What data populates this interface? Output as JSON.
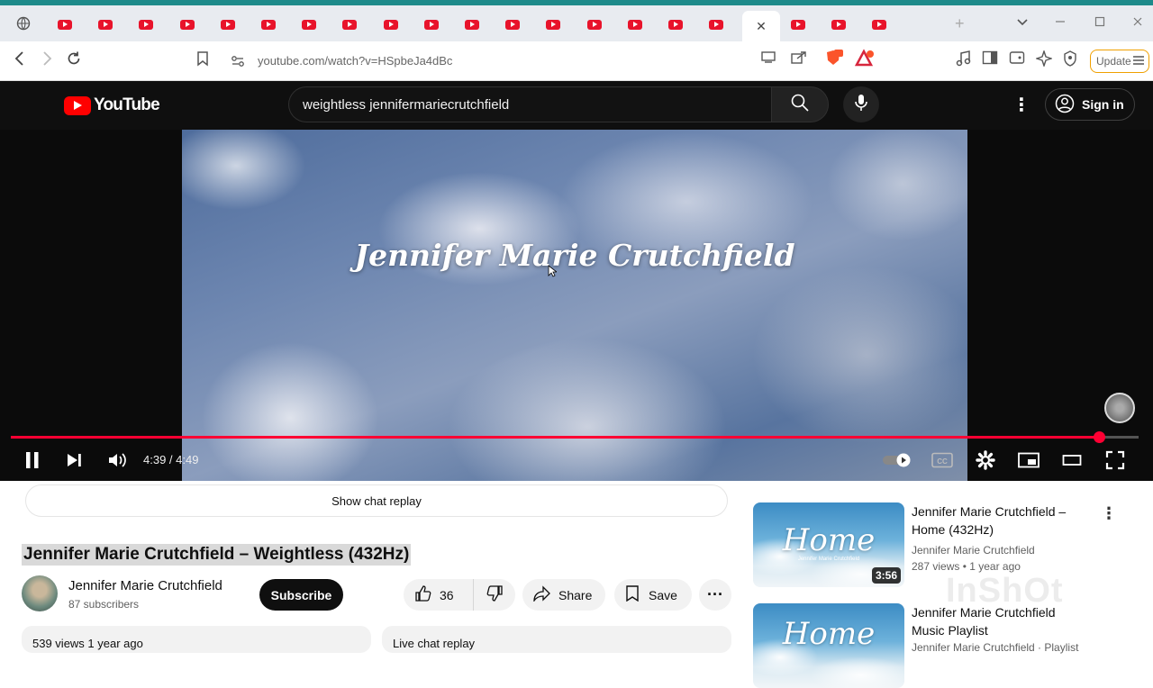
{
  "browser": {
    "tabs_count": 22,
    "active_tab_close": "✕",
    "new_tab": "+",
    "url": "youtube.com/watch?v=HSpbeJa4dBc",
    "update_label": "Update",
    "accent": "#1d8a8a"
  },
  "youtube": {
    "logo_text": "YouTube",
    "search_query": "weightless jennifermariecrutchfield",
    "sign_in": "Sign in",
    "brand_color": "#ff0000"
  },
  "player": {
    "overlay_title": "Jennifer Marie Crutchfield",
    "time": "4:39 / 4:49",
    "progress": 0.965,
    "progress_color": "#ff0033"
  },
  "chat": {
    "show_chat_replay": "Show chat replay"
  },
  "watch": {
    "title": "Jennifer Marie Crutchfield – Weightless (432Hz)",
    "channel_name": "Jennifer Marie Crutchfield",
    "subscribers": "87 subscribers",
    "subscribe_label": "Subscribe",
    "likes": "36",
    "share_label": "Share",
    "save_label": "Save",
    "description_meta": "539 views  1 year ago",
    "live_chat_label": "Live chat replay"
  },
  "related": [
    {
      "thumb_text": "Home",
      "thumb_sub": "Jennifer Marie Crutchfield",
      "duration": "3:56",
      "title": "Jennifer Marie Crutchfield – Home (432Hz)",
      "channel": "Jennifer Marie Crutchfield",
      "meta": "287 views  • 1 year ago"
    },
    {
      "thumb_text": "Home",
      "title": "Jennifer Marie Crutchfield Music Playlist",
      "channel": "Jennifer Marie Crutchfield · Playlist"
    }
  ],
  "watermark": "InShOt"
}
